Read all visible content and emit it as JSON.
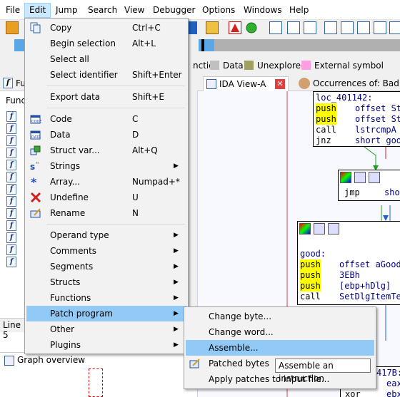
{
  "menubar": {
    "items": [
      {
        "label": "File"
      },
      {
        "label": "Edit"
      },
      {
        "label": "Jump"
      },
      {
        "label": "Search"
      },
      {
        "label": "View"
      },
      {
        "label": "Debugger"
      },
      {
        "label": "Options"
      },
      {
        "label": "Windows"
      },
      {
        "label": "Help"
      }
    ]
  },
  "legend": {
    "items": [
      {
        "label": "nction",
        "color": "#ffffff"
      },
      {
        "label": "Data",
        "color": "#c0c0c0"
      },
      {
        "label": "Unexplored",
        "color": "#a0a060"
      },
      {
        "label": "External symbol",
        "color": "#ff9ee0"
      }
    ]
  },
  "tabs": {
    "ida_view": "IDA View-A",
    "occurrences": "Occurrences of: Bad boy"
  },
  "left_panel": {
    "header": "Func",
    "tab_label": "Fu",
    "line_label": "Line 5",
    "graph_overview": "Graph overview"
  },
  "edit_menu": {
    "items": [
      {
        "label": "Copy",
        "shortcut": "Ctrl+C",
        "icon": "copy-icon"
      },
      {
        "label": "Begin selection",
        "shortcut": "Alt+L"
      },
      {
        "label": "Select all",
        "shortcut": ""
      },
      {
        "label": "Select identifier",
        "shortcut": "Shift+Enter"
      },
      {
        "label": "Export data",
        "shortcut": "Shift+E"
      },
      {
        "label": "Code",
        "shortcut": "C",
        "icon": "code-icon"
      },
      {
        "label": "Data",
        "shortcut": "D",
        "icon": "data-icon"
      },
      {
        "label": "Struct var...",
        "shortcut": "Alt+Q",
        "icon": "struct-icon"
      },
      {
        "label": "Strings",
        "shortcut": "",
        "submenu": true,
        "icon": "strings-icon"
      },
      {
        "label": "Array...",
        "shortcut": "Numpad+*",
        "icon": "array-icon"
      },
      {
        "label": "Undefine",
        "shortcut": "U",
        "icon": "undefine-icon"
      },
      {
        "label": "Rename",
        "shortcut": "N",
        "icon": "rename-icon"
      },
      {
        "label": "Operand type",
        "submenu": true
      },
      {
        "label": "Comments",
        "submenu": true
      },
      {
        "label": "Segments",
        "submenu": true
      },
      {
        "label": "Structs",
        "submenu": true
      },
      {
        "label": "Functions",
        "submenu": true
      },
      {
        "label": "Patch program",
        "submenu": true
      },
      {
        "label": "Other",
        "submenu": true
      },
      {
        "label": "Plugins",
        "submenu": true
      }
    ]
  },
  "patch_submenu": {
    "items": [
      {
        "label": "Change byte..."
      },
      {
        "label": "Change word..."
      },
      {
        "label": "Assemble..."
      },
      {
        "label": "Patched bytes",
        "icon": "patched-bytes-icon"
      },
      {
        "label": "Apply patches to input file..."
      }
    ]
  },
  "tooltip": "Assemble an instruction",
  "asm": {
    "block1": {
      "label": "loc_401142:",
      "lines": [
        {
          "mn": "push",
          "op": "offset St"
        },
        {
          "mn": "push",
          "op": "offset St"
        },
        {
          "mn": "call",
          "op": "lstrcmpA"
        },
        {
          "mn": "jnz",
          "op": "short goo"
        }
      ]
    },
    "block2": {
      "mn": "jmp",
      "op": "shor"
    },
    "block3": {
      "label": "good:",
      "lines": [
        {
          "mn": "push",
          "op": "offset aGood"
        },
        {
          "mn": "push",
          "op": "3EBh"
        },
        {
          "mn": "push",
          "op": "[ebp+hDlg]"
        },
        {
          "mn": "call",
          "op": "SetDlgItemTe"
        },
        {
          "mn": "",
          "op": "c_40"
        }
      ]
    },
    "block4": {
      "label": "417B:",
      "lines": [
        {
          "mn": "",
          "op": "eax"
        },
        {
          "mn": "xor",
          "op": "ebx"
        }
      ]
    }
  },
  "colors": {
    "menu_highlight": "#91c9f7",
    "menubar_active": "#cce8ff",
    "yellow_hl": "#ffff00"
  }
}
